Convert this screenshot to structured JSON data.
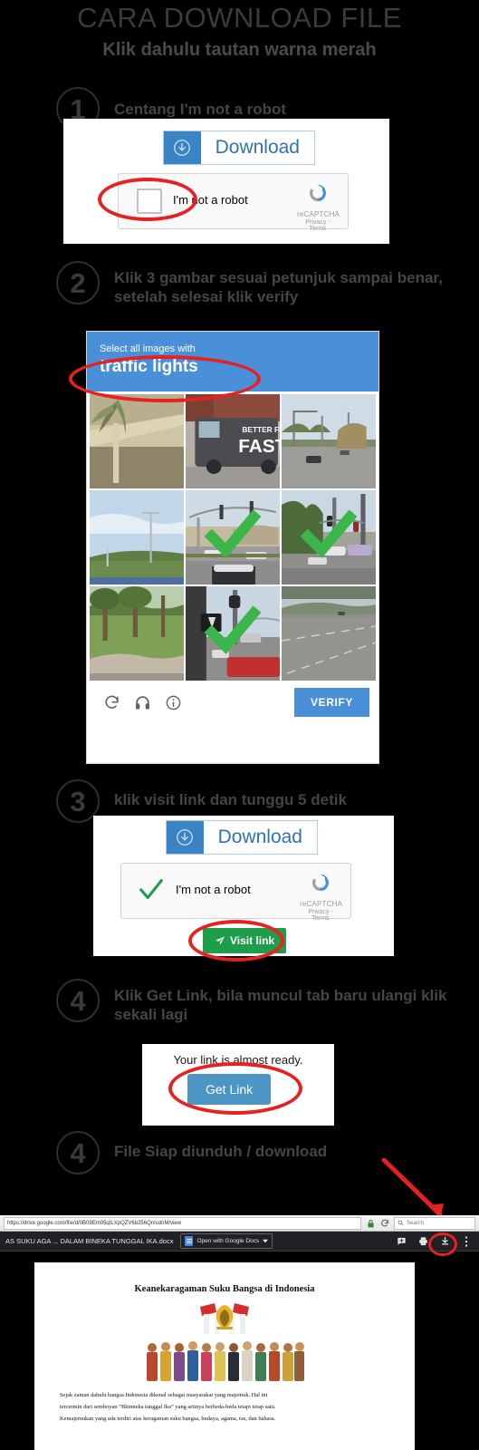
{
  "header": {
    "title": "CARA DOWNLOAD FILE",
    "subtitle": "Klik dahulu tautan warna merah"
  },
  "steps": [
    {
      "number": "1",
      "text": "Centang I'm not a robot"
    },
    {
      "number": "2",
      "text": "Klik 3 gambar sesuai petunjuk sampai benar, setelah selesai klik verify"
    },
    {
      "number": "3",
      "text": "klik visit link dan tunggu 5 detik"
    },
    {
      "number": "4",
      "text": "Klik Get Link, bila muncul tab baru ulangi klik sekali lagi"
    },
    {
      "number": "4",
      "text": "File Siap diunduh / download"
    }
  ],
  "download_button": {
    "label": "Download",
    "icon": "download-arrow-circle-icon"
  },
  "recaptcha_unchecked": {
    "label": "I'm not a robot",
    "brand": "reCAPTCHA",
    "terms": "Privacy - Terms",
    "state": "unchecked"
  },
  "recaptcha_checked": {
    "label": "I'm not a robot",
    "brand": "reCAPTCHA",
    "terms": "Privacy - Terms",
    "state": "checked"
  },
  "captcha_challenge": {
    "prompt_line1": "Select all images with",
    "prompt_line2": "traffic lights",
    "verify_label": "VERIFY",
    "footer_icons": [
      "reload-icon",
      "audio-headphone-icon",
      "info-icon"
    ],
    "tiles": [
      {
        "index": 1,
        "selected": false,
        "description": "palm plant beside beige building"
      },
      {
        "index": 2,
        "selected": false,
        "description": "bus with BETTER FRESH FASTER ad"
      },
      {
        "index": 3,
        "selected": false,
        "description": "road with trees and cars"
      },
      {
        "index": 4,
        "selected": false,
        "description": "sky with light pole over hedge"
      },
      {
        "index": 5,
        "selected": true,
        "description": "intersection with traffic signal arm"
      },
      {
        "index": 6,
        "selected": true,
        "description": "street with traffic light and vans"
      },
      {
        "index": 7,
        "selected": false,
        "description": "grass lawn with trees and sidewalk"
      },
      {
        "index": 8,
        "selected": true,
        "description": "crosswalk signal pole with red van"
      },
      {
        "index": 9,
        "selected": false,
        "description": "empty highway lanes"
      }
    ]
  },
  "visit_link_button": {
    "label": "Visit link",
    "icon": "paper-plane-icon"
  },
  "get_link_panel": {
    "message": "Your link is almost ready.",
    "button_label": "Get Link"
  },
  "browser": {
    "url": "https://drive.google.com/file/d/0B09Em05qILXpQZV6b256QnIsdnM/view",
    "url_bold_part": "google.com",
    "search_placeholder": "Search",
    "lock_icon": "lock-icon",
    "reload_icon": "reload-icon",
    "search_icon": "search-icon",
    "drive_file_name": "AS SUKU AGA ... DALAM BINEKA TUNGGAL IKA.docx",
    "open_with_label": "Open with Google Docs",
    "dropdown_icon": "chevron-down-icon",
    "toolbar_icons": [
      "add-comment-icon",
      "print-icon",
      "download-icon",
      "more-options-icon"
    ]
  },
  "document": {
    "title": "Keanekaragaman Suku Bangsa di Indonesia",
    "emblem": "garuda-pancasila-emblem",
    "illustration": "indonesian-traditional-clothing-people",
    "paragraph_lines": [
      "Sejak zaman dahulu bangsa Indonesia dikenal sebagai masyarakat yang majemuk. Hal ini",
      "tercermin dari semboyan “Bhinneka tunggal Ika” yang artinya berbeda-beda tetapi tetap satu.",
      "Kemajemukan yang ada terdiri atas keragaman suku bangsa, budaya, agama, ras, dan bahasa."
    ]
  },
  "colors": {
    "annotation_red": "#e8201f",
    "captcha_blue": "#4a90d9",
    "download_blue": "#3a83c4",
    "visit_green": "#1e9e4a",
    "getlink_blue": "#4b96c4",
    "check_green": "#3cb54a"
  }
}
